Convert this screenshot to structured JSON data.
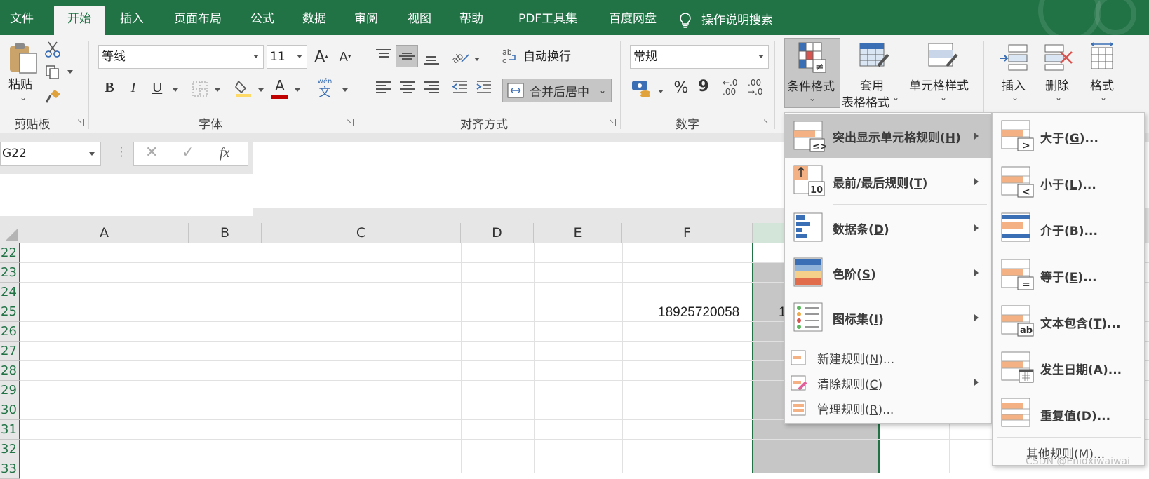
{
  "tabs": [
    {
      "label": "文件"
    },
    {
      "label": "开始"
    },
    {
      "label": "插入"
    },
    {
      "label": "页面布局"
    },
    {
      "label": "公式"
    },
    {
      "label": "数据"
    },
    {
      "label": "审阅"
    },
    {
      "label": "视图"
    },
    {
      "label": "帮助"
    },
    {
      "label": "PDF工具集"
    },
    {
      "label": "百度网盘"
    }
  ],
  "active_tab": "开始",
  "tell_me": "操作说明搜索",
  "ribbon": {
    "clipboard": {
      "paste": "粘贴",
      "group": "剪贴板"
    },
    "font": {
      "name": "等线",
      "size": "11",
      "bold": "B",
      "italic": "I",
      "underline": "U",
      "group": "字体",
      "phonetic_top": "wén",
      "phonetic": "文",
      "grow": "A",
      "shrink": "A",
      "font_color": "A"
    },
    "alignment": {
      "wrap": "自动换行",
      "merge": "合并后居中",
      "group": "对齐方式",
      "orient": "ab"
    },
    "number": {
      "format": "常规",
      "percent": "%",
      "comma": "9",
      "inc_decimal_top": "←.0",
      "inc_decimal_bottom": ".00",
      "dec_decimal_top": ".00",
      "dec_decimal_bottom": "→.0",
      "group": "数字"
    },
    "styles": {
      "conditional": "条件格式",
      "table_format_line1": "套用",
      "table_format_line2": "表格格式",
      "cell_styles": "单元格样式"
    },
    "cells": {
      "insert": "插入",
      "delete": "删除",
      "format": "格式"
    }
  },
  "formula_bar": {
    "name_box": "G22",
    "fx": "fx",
    "value": ""
  },
  "columns": [
    "A",
    "B",
    "C",
    "D",
    "E",
    "F"
  ],
  "rows": [
    "22",
    "23",
    "24",
    "25",
    "26",
    "27",
    "28",
    "29",
    "30",
    "31",
    "32",
    "33"
  ],
  "cells": {
    "F25": "18925720058",
    "G25_partial": "1"
  },
  "cf_menu": {
    "items": [
      {
        "label": "突出显示单元格规则",
        "key": "H"
      },
      {
        "label": "最前/最后规则",
        "key": "T"
      },
      {
        "label": "数据条",
        "key": "D"
      },
      {
        "label": "色阶",
        "key": "S"
      },
      {
        "label": "图标集",
        "key": "I"
      }
    ],
    "small_items": [
      {
        "label": "新建规则",
        "key": "N",
        "suffix": "..."
      },
      {
        "label": "清除规则",
        "key": "C",
        "suffix": ""
      },
      {
        "label": "管理规则",
        "key": "R",
        "suffix": "..."
      }
    ],
    "icon_top10": "10"
  },
  "sub_menu": {
    "items": [
      {
        "label": "大于",
        "key": "G",
        "suffix": "..."
      },
      {
        "label": "小于",
        "key": "L",
        "suffix": "..."
      },
      {
        "label": "介于",
        "key": "B",
        "suffix": "..."
      },
      {
        "label": "等于",
        "key": "E",
        "suffix": "..."
      },
      {
        "label": "文本包含",
        "key": "T",
        "suffix": "..."
      },
      {
        "label": "发生日期",
        "key": "A",
        "suffix": "..."
      },
      {
        "label": "重复值",
        "key": "D",
        "suffix": "..."
      }
    ],
    "other": {
      "label": "其他规则",
      "key": "M",
      "suffix": "..."
    },
    "badges": [
      ">",
      "<",
      "",
      "=",
      "ab",
      "",
      ""
    ]
  },
  "watermark": "CSDN @Enidxiwaiwai",
  "colors": {
    "excel_green": "#217346",
    "highlight_orange": "#f4b183",
    "selected_gray": "#c6c6c6"
  }
}
